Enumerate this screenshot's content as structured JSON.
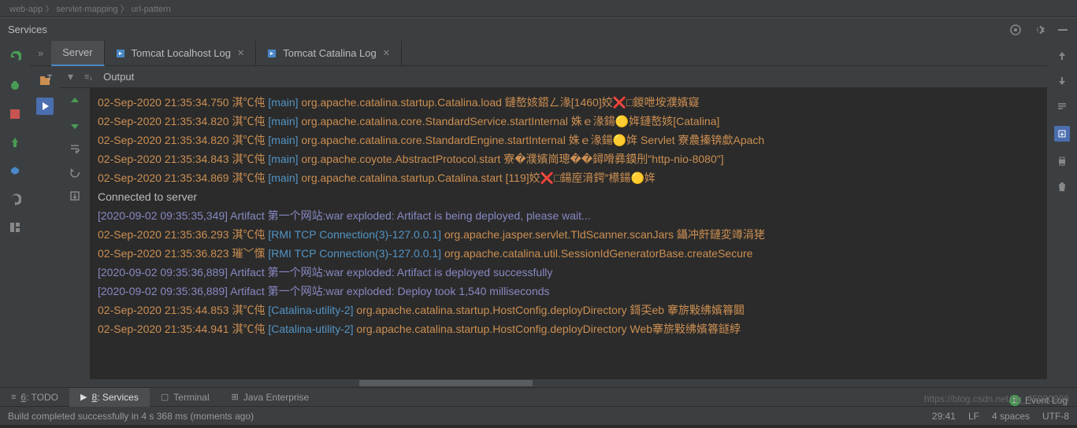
{
  "breadcrumb": "web-app 〉 servlet-mapping 〉 url-pattern",
  "panel_title": "Services",
  "tabs": [
    {
      "label": "Server",
      "closable": false
    },
    {
      "label": "Tomcat Localhost Log",
      "closable": true
    },
    {
      "label": "Tomcat Catalina Log",
      "closable": true
    }
  ],
  "tree_label": "T",
  "output_header": {
    "filter_label": "≡₁",
    "label": "Output"
  },
  "console_lines": [
    {
      "ts": "02-Sep-2020 21:35:34.750",
      "lv": "淇℃伅",
      "th": "[main]",
      "cl": "org.apache.catalina.startup.Catalina.load",
      "msg": "鏈嶅姟鍣ㄥ湪[1460]姣❌□鍐呭垵濮嬪寲"
    },
    {
      "ts": "02-Sep-2020 21:35:34.820",
      "lv": "淇℃伅",
      "th": "[main]",
      "cl": "org.apache.catalina.core.StandardService.startInternal",
      "msg": "姝ｅ湪鍚🟡姩鏈嶅姟[Catalina]"
    },
    {
      "ts": "02-Sep-2020 21:35:34.820",
      "lv": "淇℃伅",
      "th": "[main]",
      "cl": "org.apache.catalina.core.StandardEngine.startInternal",
      "msg": "姝ｅ湪鍚🟡姩 Servlet 寮曟搸锛歔Apach"
    },
    {
      "ts": "02-Sep-2020 21:35:34.843",
      "lv": "淇℃伅",
      "th": "[main]",
      "cl": "org.apache.coyote.AbstractProtocol.start",
      "msg": "寮�濮嬪崗璁��鐞嗗彞鏌刐\"http-nio-8080\"]"
    },
    {
      "ts": "02-Sep-2020 21:35:34.869",
      "lv": "淇℃伅",
      "th": "[main]",
      "cl": "org.apache.catalina.startup.Catalina.start",
      "msg": "[119]姣❌□鍚庢湇鍔″櫒鍚🟡姩"
    },
    {
      "conn": "Connected to server"
    },
    {
      "art": "[2020-09-02 09:35:35,349] Artifact 第一个网站:war exploded: Artifact is being deployed, please wait..."
    },
    {
      "ts": "02-Sep-2020 21:35:36.293",
      "lv": "淇℃伅",
      "th": "[RMI TCP Connection(3)-127.0.0.1]",
      "cl": "org.apache.jasper.servlet.TldScanner.scanJars",
      "msg": "鑷冲皯鏈変竴涓狫"
    },
    {
      "ts": "02-Sep-2020 21:35:36.823",
      "lv": "璀﹀憡",
      "th": "[RMI TCP Connection(3)-127.0.0.1]",
      "cl": "org.apache.catalina.util.SessionIdGeneratorBase.createSecure",
      "msg": ""
    },
    {
      "art": "[2020-09-02 09:35:36,889] Artifact 第一个网站:war exploded: Artifact is deployed successfully"
    },
    {
      "art": "[2020-09-02 09:35:36,889] Artifact 第一个网站:war exploded: Deploy took 1,540 milliseconds"
    },
    {
      "ts": "02-Sep-2020 21:35:44.853",
      "lv": "淇℃伅",
      "th": "[Catalina-utility-2]",
      "cl": "org.apache.catalina.startup.HostConfig.deployDirectory",
      "msg": "鎶奀eb 搴旂敤绋嬪簭閮"
    },
    {
      "ts": "02-Sep-2020 21:35:44.941",
      "lv": "淇℃伅",
      "th": "[Catalina-utility-2]",
      "cl": "org.apache.catalina.startup.HostConfig.deployDirectory",
      "msg": "Web搴旂敤绋嬪簭鐩綍"
    }
  ],
  "bottom_tabs": [
    {
      "icon": "≡",
      "label": "6: TODO",
      "underline": "6"
    },
    {
      "icon": "▶",
      "label": "8: Services",
      "underline": "8",
      "active": true
    },
    {
      "icon": "▢",
      "label": "Terminal"
    },
    {
      "icon": "⊞",
      "label": "Java Enterprise"
    }
  ],
  "event_log": {
    "badge": "2",
    "label": "Event Log"
  },
  "status": {
    "message": "Build completed successfully in 4 s 368 ms (moments ago)",
    "position": "29:41",
    "line_sep": "LF",
    "indent": "4 spaces",
    "encoding": "UTF-8"
  },
  "watermark": "https://blog.csdn.net/qq_45930996"
}
